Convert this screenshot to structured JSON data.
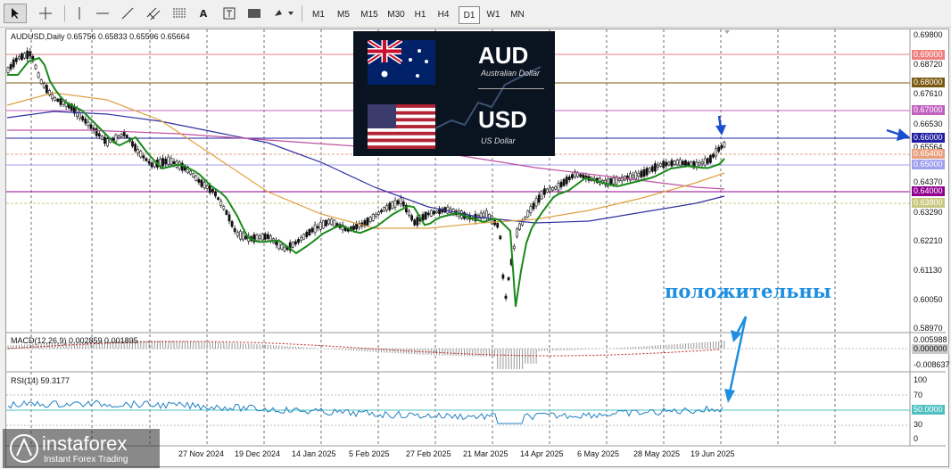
{
  "toolbar": {
    "timeframes": [
      "M1",
      "M5",
      "M15",
      "M30",
      "H1",
      "H4",
      "D1",
      "W1",
      "MN"
    ],
    "active_timeframe": "D1"
  },
  "chart": {
    "header": "AUDUSD,Daily  0.65756 0.65833 0.65596 0.65664",
    "price_axis": [
      "0.69800",
      "0.68720",
      "0.67610",
      "0.66530",
      "0.65564",
      "0.64370",
      "0.63290",
      "0.62210",
      "0.61130",
      "0.60050",
      "0.58970"
    ],
    "price_tags": [
      {
        "text": "0.69000",
        "bg": "#f08080",
        "fg": "#ffffff"
      },
      {
        "text": "0.68000",
        "bg": "#7a5a10",
        "fg": "#ffffff"
      },
      {
        "text": "0.67000",
        "bg": "#c060c0",
        "fg": "#ffffff"
      },
      {
        "text": "0.66000",
        "bg": "#2020a0",
        "fg": "#ffffff"
      },
      {
        "text": "0.65400",
        "bg": "#e8a080",
        "fg": "#ffffff"
      },
      {
        "text": "0.65000",
        "bg": "#a0a0f0",
        "fg": "#ffffff"
      },
      {
        "text": "0.64000",
        "bg": "#900090",
        "fg": "#ffffff"
      },
      {
        "text": "0.63800",
        "bg": "#c8c880",
        "fg": "#ffffff"
      }
    ],
    "dates": [
      "27 Nov 2024",
      "19 Dec 2024",
      "14 Jan 2025",
      "5 Feb 2025",
      "27 Feb 2025",
      "21 Mar 2025",
      "14 Apr 2025",
      "6 May 2025",
      "28 May 2025",
      "19 Jun 2025"
    ],
    "banner": {
      "base": "AUD",
      "base_name": "Australian Dollar",
      "quote": "USD",
      "quote_name": "US Dollar"
    },
    "annotation": "положительны"
  },
  "macd": {
    "label": "MACD(12,26,9) 0.002859 0.001895",
    "axis": [
      "0.005988",
      "0.000000",
      "-0.008637"
    ]
  },
  "rsi": {
    "label": "RSI(14) 59.3177",
    "axis": [
      "100",
      "70",
      "50.0000",
      "30",
      "0"
    ]
  },
  "logo": {
    "name": "instaforex",
    "tagline": "Instant Forex Trading"
  },
  "colors": {
    "accent": "#1e8fe0",
    "ma_fast": "#1a8a1a",
    "ma_mid": "#e0a040",
    "ma_slow": "#3030a0"
  }
}
